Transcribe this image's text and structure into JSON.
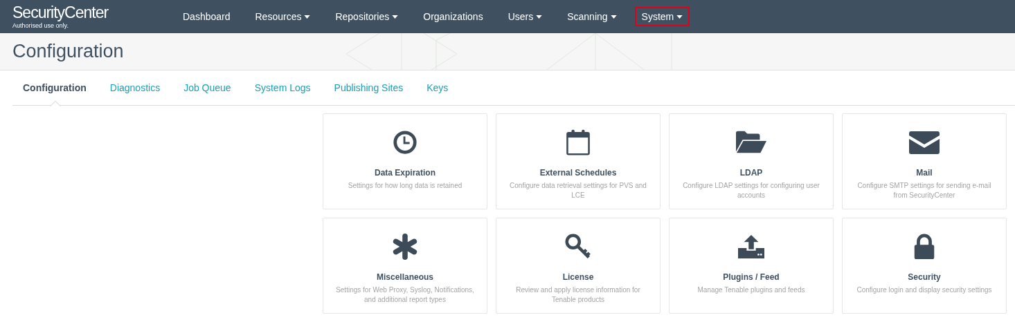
{
  "brand": {
    "name": "SecurityCenter",
    "tagline": "Authorised use only."
  },
  "nav": [
    {
      "label": "Dashboard",
      "dropdown": false,
      "highlighted": false
    },
    {
      "label": "Resources",
      "dropdown": true,
      "highlighted": false
    },
    {
      "label": "Repositories",
      "dropdown": true,
      "highlighted": false
    },
    {
      "label": "Organizations",
      "dropdown": false,
      "highlighted": false
    },
    {
      "label": "Users",
      "dropdown": true,
      "highlighted": false
    },
    {
      "label": "Scanning",
      "dropdown": true,
      "highlighted": false
    },
    {
      "label": "System",
      "dropdown": true,
      "highlighted": true
    }
  ],
  "page_title": "Configuration",
  "tabs": [
    {
      "label": "Configuration",
      "selected": true
    },
    {
      "label": "Diagnostics",
      "selected": false
    },
    {
      "label": "Job Queue",
      "selected": false
    },
    {
      "label": "System Logs",
      "selected": false
    },
    {
      "label": "Publishing Sites",
      "selected": false
    },
    {
      "label": "Keys",
      "selected": false
    }
  ],
  "cards": [
    {
      "kind": "clock",
      "title": "Data Expiration",
      "description": "Settings for how long data is retained"
    },
    {
      "kind": "calendar",
      "title": "External Schedules",
      "description": "Configure data retrieval settings for PVS and LCE"
    },
    {
      "kind": "folder",
      "title": "LDAP",
      "description": "Configure LDAP settings for configuring user accounts"
    },
    {
      "kind": "envelope",
      "title": "Mail",
      "description": "Configure SMTP settings for sending e-mail from SecurityCenter"
    },
    {
      "kind": "asterisk",
      "title": "Miscellaneous",
      "description": "Settings for Web Proxy, Syslog, Notifications, and additional report types"
    },
    {
      "kind": "key",
      "title": "License",
      "description": "Review and apply license information for Tenable products"
    },
    {
      "kind": "upload",
      "title": "Plugins / Feed",
      "description": "Manage Tenable plugins and feeds"
    },
    {
      "kind": "lock",
      "title": "Security",
      "description": "Configure login and display security settings"
    }
  ]
}
